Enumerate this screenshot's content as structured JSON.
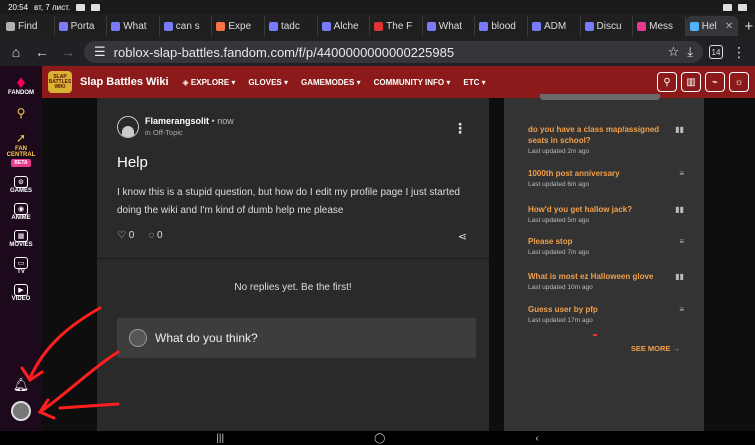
{
  "status_bar": {
    "time": "20:54",
    "date": "вт, 7 лист."
  },
  "tabs": [
    {
      "label": "Find",
      "favicon_color": "#b0b0b0",
      "active": false
    },
    {
      "label": "Porta",
      "favicon_color": "#7a7aff",
      "active": false
    },
    {
      "label": "What",
      "favicon_color": "#7a7aff",
      "active": false
    },
    {
      "label": "can s",
      "favicon_color": "#7a7aff",
      "active": false
    },
    {
      "label": "Expe",
      "favicon_color": "#ff7043",
      "active": false
    },
    {
      "label": "tadc",
      "favicon_color": "#7a7aff",
      "active": false
    },
    {
      "label": "Alche",
      "favicon_color": "#7a7aff",
      "active": false
    },
    {
      "label": "The F",
      "favicon_color": "#d33",
      "active": false
    },
    {
      "label": "What",
      "favicon_color": "#7a7aff",
      "active": false
    },
    {
      "label": "blood",
      "favicon_color": "#7a7aff",
      "active": false
    },
    {
      "label": "ADM",
      "favicon_color": "#7a7aff",
      "active": false
    },
    {
      "label": "Discu",
      "favicon_color": "#7a7aff",
      "active": false
    },
    {
      "label": "Mess",
      "favicon_color": "#e63a8e",
      "active": false
    },
    {
      "label": "Hel",
      "favicon_color": "#4fb3ff",
      "active": true
    }
  ],
  "address_bar": {
    "url": "roblox-slap-battles.fandom.com/f/p/4400000000000225985",
    "tab_count": "14"
  },
  "rail": {
    "fandom_label": "FANDOM",
    "fan_central_label": "FAN CENTRAL",
    "beta_label": "BETA",
    "games_label": "GAMES",
    "anime_label": "ANIME",
    "movies_label": "MOVIES",
    "tv_label": "TV",
    "video_label": "VIDEO"
  },
  "wiki_header": {
    "logo_text": "SLAP BATTLES WIKI",
    "name": "Slap Battles Wiki",
    "nav": [
      "EXPLORE",
      "GLOVES",
      "GAMEMODES",
      "COMMUNITY INFO",
      "ETC"
    ]
  },
  "post": {
    "author": "Flamerangsolit",
    "separator": "•",
    "time": "now",
    "category": "in Off-Topic",
    "title": "Help",
    "body": "I know this is a stupid question, but how do I edit my profile page I just started doing the wiki and I'm kind of dumb help me please",
    "likes": "0",
    "comments": "0",
    "no_replies": "No replies yet. Be the first!",
    "reply_placeholder": "What do you think?"
  },
  "sidebar": {
    "trending": [
      {
        "title": "do you have a class map/assigned seats in school?",
        "updated": "Last updated 2m ago",
        "type_icon": "poll-icon"
      },
      {
        "title": "1000th post anniversary",
        "updated": "Last updated 6m ago",
        "type_icon": "text-icon"
      },
      {
        "title": "How'd you get hallow jack?",
        "updated": "Last updated 5m ago",
        "type_icon": "poll-icon"
      },
      {
        "title": "Please stop",
        "updated": "Last updated 7m ago",
        "type_icon": "text-icon"
      },
      {
        "title": "What is most ez Halloween glove",
        "updated": "Last updated 10m ago",
        "type_icon": "poll-icon"
      },
      {
        "title": "Guess user by pfp",
        "updated": "Last updated 17m ago",
        "type_icon": "text-icon"
      }
    ],
    "see_more": "SEE MORE"
  }
}
